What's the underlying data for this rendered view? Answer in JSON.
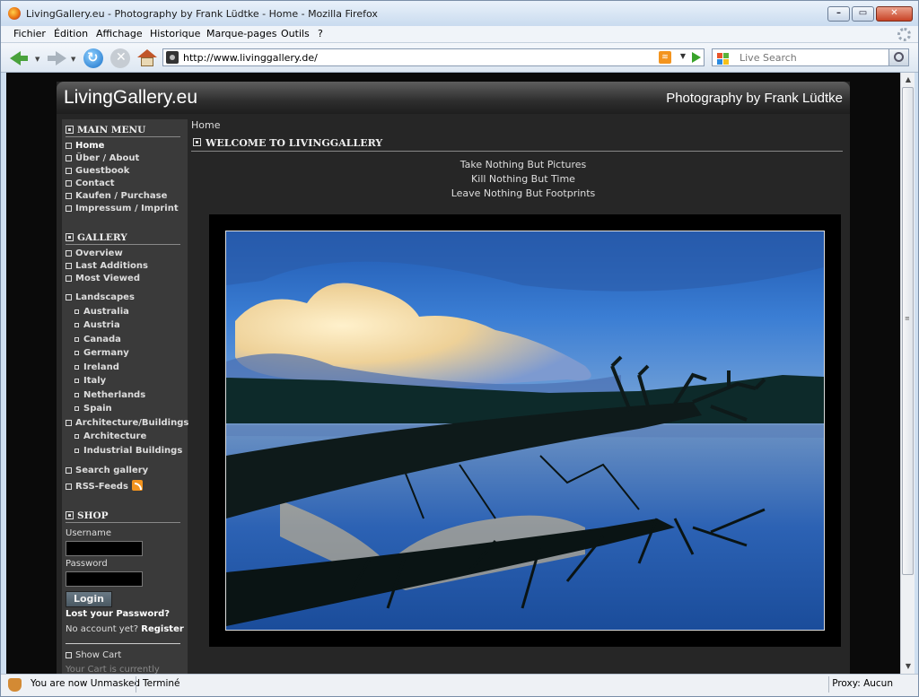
{
  "window": {
    "title": "LivingGallery.eu - Photography by Frank Lüdtke - Home - Mozilla Firefox",
    "minimize_glyph": "–",
    "maximize_glyph": "▭",
    "close_glyph": "✕"
  },
  "menubar": {
    "items": [
      "Fichier",
      "Édition",
      "Affichage",
      "Historique",
      "Marque-pages",
      "Outils",
      "?"
    ]
  },
  "navbar": {
    "url": "http://www.livinggallery.de/",
    "search_placeholder": "Live Search",
    "rss_glyph": "≋",
    "dropdown_glyph": "▼"
  },
  "site": {
    "logo": "LivingGallery.eu",
    "tagline": "Photography by Frank Lüdtke",
    "main_menu": {
      "title": "MAIN MENU",
      "items": [
        "Home",
        "Über / About",
        "Guestbook",
        "Contact",
        "Kaufen / Purchase",
        "Impressum / Imprint"
      ]
    },
    "gallery": {
      "title": "GALLERY",
      "items": [
        "Overview",
        "Last Additions",
        "Most Viewed",
        "Landscapes"
      ],
      "landscapes": [
        "Australia",
        "Austria",
        "Canada",
        "Germany",
        "Ireland",
        "Italy",
        "Netherlands",
        "Spain"
      ],
      "architecture_title": "Architecture/Buildings",
      "architecture": [
        "Architecture",
        "Industrial Buildings"
      ],
      "search": "Search gallery",
      "rss": "RSS-Feeds"
    },
    "shop": {
      "title": "SHOP",
      "username_label": "Username",
      "password_label": "Password",
      "login_button": "Login",
      "lost_password": "Lost your Password?",
      "no_account": "No account yet?",
      "register": "Register",
      "show_cart": "Show Cart",
      "cart_text": "Your Cart is currently"
    },
    "breadcrumb": "Home",
    "welcome_title": "WELCOME TO LIVINGGALLERY",
    "quotes": [
      "Take Nothing But Pictures",
      "Kill Nothing But Time",
      "Leave Nothing But Footprints"
    ]
  },
  "statusbar": {
    "left": "You are now Unmasked",
    "middle": "Terminé",
    "right": "Proxy: Aucun"
  },
  "colors": {
    "sky": "#2a6fc0",
    "water": "#1c4f9a",
    "cloud": "#f3d79a"
  }
}
